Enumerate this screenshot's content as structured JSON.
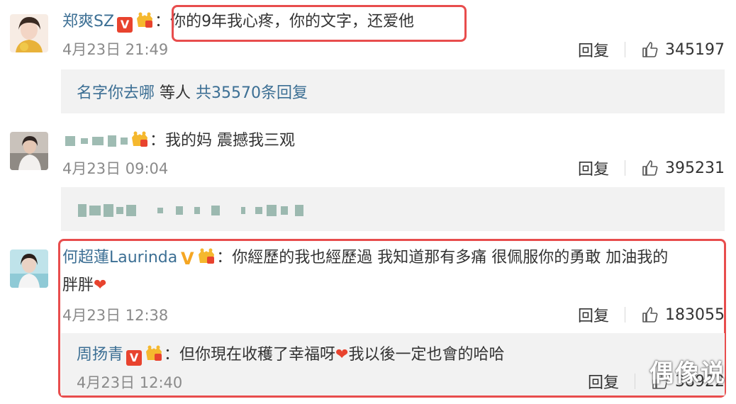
{
  "comments": [
    {
      "username": "郑爽SZ",
      "text": "你的9年我心疼，你的文字，还爱他",
      "date": "4月23日 21:49",
      "reply_label": "回复",
      "likes": "345197",
      "replies_summary": {
        "user": "名字你去哪",
        "middle": "等人",
        "count": "共35570条回复"
      }
    },
    {
      "username": "",
      "text": "我的妈 震撼我三观",
      "date": "4月23日 09:04",
      "reply_label": "回复",
      "likes": "395231"
    },
    {
      "username": "何超蓮Laurinda",
      "text_line1": "你經歷的我也經歷過 我知道那有多痛 很佩服你的勇敢 加油我的",
      "text_line2": "胖胖",
      "date": "4月23日 12:38",
      "reply_label": "回复",
      "likes": "183055",
      "sub_reply": {
        "username": "周扬青",
        "text_part1": "但你現在收穫了幸福呀",
        "text_part2": "我以後一定也會的哈哈",
        "date": "4月23日 12:40",
        "reply_label": "回复",
        "likes": "38922"
      }
    }
  ],
  "watermark": "偶像说",
  "colors": {
    "username": "#3c6f94",
    "frame": "#e84d4d",
    "reply_bg": "#f2f2f2",
    "meta": "#8a8a8a"
  },
  "icons": [
    "thumbs-up-icon",
    "v-verified-badge",
    "crown-badge",
    "heart-emoji"
  ]
}
